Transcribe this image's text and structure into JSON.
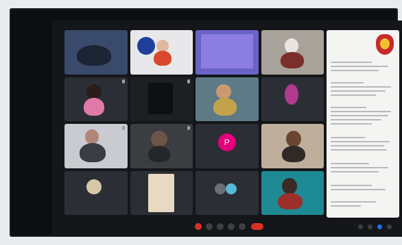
{
  "meeting": {
    "caption": "",
    "time": ""
  },
  "tiles": [
    {
      "name": ""
    },
    {
      "name": ""
    },
    {
      "name": ""
    },
    {
      "name": ""
    },
    {
      "name": ""
    },
    {
      "name": ""
    },
    {
      "name": ""
    },
    {
      "name": ""
    },
    {
      "name": ""
    },
    {
      "name": ""
    },
    {
      "name": ""
    },
    {
      "name": ""
    },
    {
      "name": ""
    },
    {
      "name": ""
    },
    {
      "name": ""
    },
    {
      "name": ""
    }
  ],
  "avatar": {
    "letter": "P"
  },
  "colors": {
    "leave": "#d93025",
    "avatar": "#e4007c",
    "crest": "#c72a2a"
  },
  "icons": {
    "toolbar": [
      "mic-icon",
      "camera-icon",
      "captions-icon",
      "present-icon",
      "more-icon",
      "leave-call-icon"
    ],
    "right": [
      "info-icon",
      "people-icon",
      "chat-icon",
      "activities-icon"
    ]
  }
}
